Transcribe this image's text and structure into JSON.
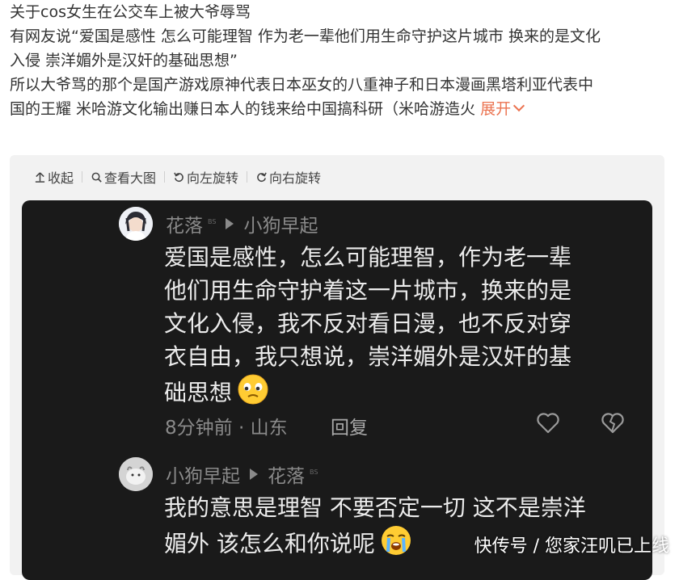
{
  "post": {
    "lines": [
      "关于cos女生在公交车上被大爷辱骂",
      "有网友说“爱国是感性 怎么可能理智 作为老一辈他们用生命守护这片城市 换来的是文化",
      "入侵 崇洋媚外是汉奸的基础思想”",
      "所以大爷骂的那个是国产游戏原神代表日本巫女的八重神子和日本漫画黑塔利亚代表中"
    ],
    "last_line": "国的王耀 米哈游文化输出赚日本人的钱来给中国搞科研（米哈游造火",
    "expand_label": "展开"
  },
  "toolbar": {
    "collapse": "收起",
    "view_large": "查看大图",
    "rotate_left": "向左旋转",
    "rotate_right": "向右旋转"
  },
  "comment1": {
    "author": "花落",
    "badge": "BS",
    "reply_to": "小狗早起",
    "body_lines": [
      "爱国是感性，怎么可能理智，作为老一辈",
      "他们用生命守护着这一片城市，换来的是",
      "文化入侵，我不反对看日漫，也不反对穿",
      "衣自由，我只想说，崇洋媚外是汉奸的基"
    ],
    "body_last": "础思想",
    "meta": "8分钟前 · 山东",
    "reply_label": "回复"
  },
  "comment2": {
    "author": "小狗早起",
    "reply_to": "花落",
    "badge": "BS",
    "body_lines": [
      "我的意思是理智 不要否定一切 这不是崇洋"
    ],
    "body_last": "媚外 该怎么和你说呢"
  },
  "watermark": "快传号 / 您家汪叽已上线",
  "colors": {
    "accent": "#eb7350",
    "dark_bg": "#1a1a1a",
    "card_bg": "#f2f2f2"
  }
}
